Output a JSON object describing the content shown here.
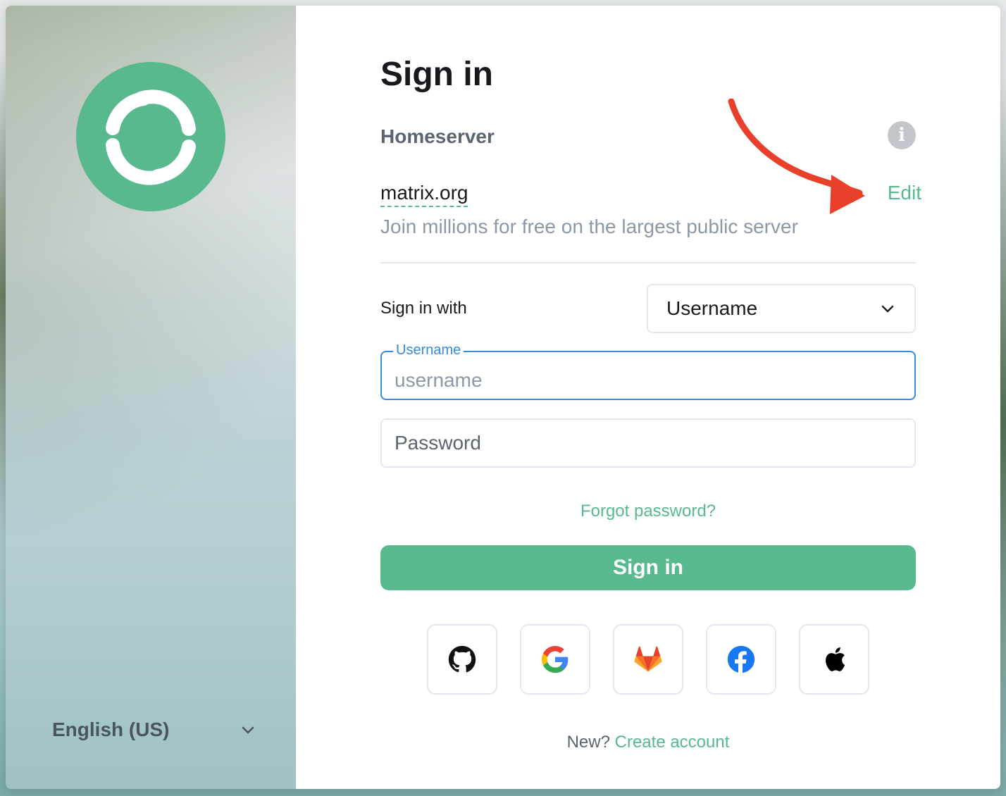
{
  "sidebar": {
    "language": "English (US)"
  },
  "login": {
    "title": "Sign in",
    "homeserver_label": "Homeserver",
    "homeserver_name": "matrix.org",
    "homeserver_edit": "Edit",
    "homeserver_desc": "Join millions for free on the largest public server",
    "sign_in_with_label": "Sign in with",
    "sign_in_with_value": "Username",
    "username_label": "Username",
    "username_placeholder": "username",
    "username_value": "",
    "password_placeholder": "Password",
    "password_value": "",
    "forgot_password": "Forgot password?",
    "submit": "Sign in",
    "sso_providers": [
      "github-icon",
      "google-icon",
      "gitlab-icon",
      "facebook-icon",
      "apple-icon"
    ],
    "footer_prefix": "New?",
    "footer_link": "Create account"
  },
  "colors": {
    "accent": "#57b98d",
    "focus": "#368bd6",
    "annotation_arrow": "#e8402a"
  }
}
